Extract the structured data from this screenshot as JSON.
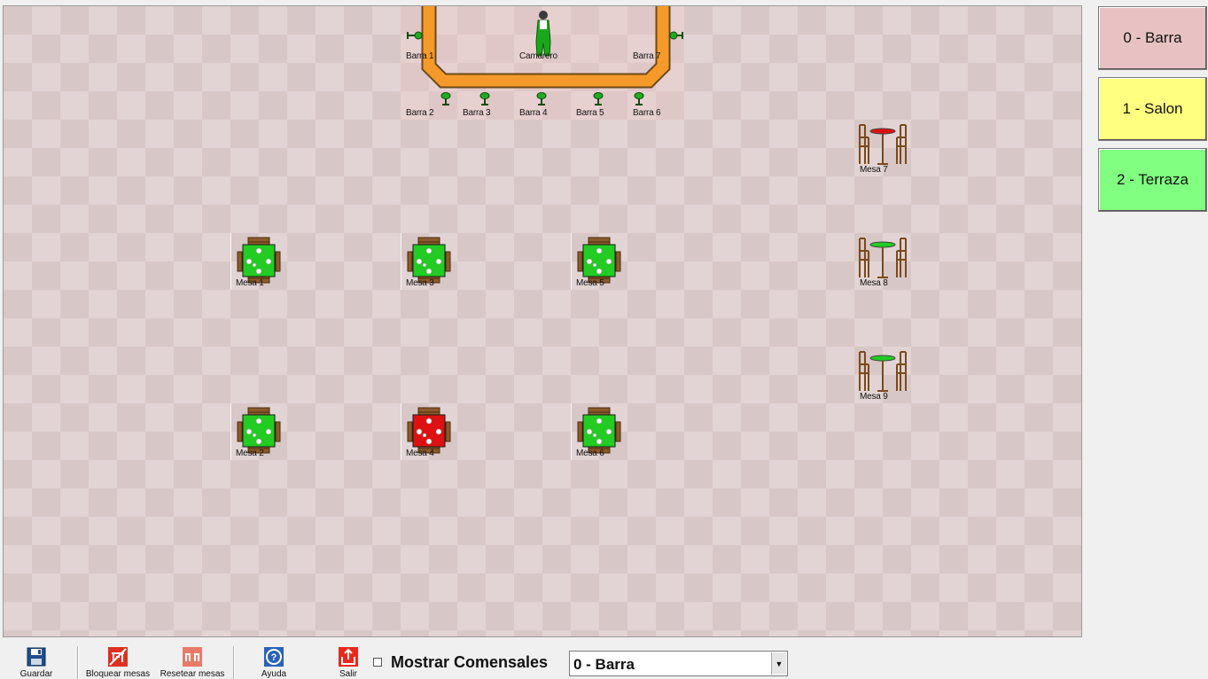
{
  "floor": {
    "bar_area": {
      "stools": [
        {
          "label": "Barra 1",
          "pos": "left"
        },
        {
          "label": "Barra 7",
          "pos": "right"
        },
        {
          "label": "Barra 2"
        },
        {
          "label": "Barra 3"
        },
        {
          "label": "Barra 4"
        },
        {
          "label": "Barra 5"
        },
        {
          "label": "Barra 6"
        }
      ],
      "waiter_label": "Camarero"
    },
    "tables": [
      {
        "label": "Mesa 1",
        "type": "square-4",
        "status": "free"
      },
      {
        "label": "Mesa 2",
        "type": "square-4",
        "status": "free"
      },
      {
        "label": "Mesa 3",
        "type": "square-4",
        "status": "free"
      },
      {
        "label": "Mesa 4",
        "type": "square-4",
        "status": "occupied"
      },
      {
        "label": "Mesa 5",
        "type": "square-4",
        "status": "free"
      },
      {
        "label": "Mesa 6",
        "type": "square-4",
        "status": "free"
      },
      {
        "label": "Mesa 7",
        "type": "high-round",
        "status": "occupied"
      },
      {
        "label": "Mesa 8",
        "type": "high-round",
        "status": "free"
      },
      {
        "label": "Mesa 9",
        "type": "high-round",
        "status": "free"
      }
    ]
  },
  "zones": [
    {
      "label": "0 - Barra",
      "color": "#e8c2c2"
    },
    {
      "label": "1 - Salon",
      "color": "#ffff80"
    },
    {
      "label": "2 - Terraza",
      "color": "#80ff80"
    }
  ],
  "toolbar": {
    "save_label": "Guardar",
    "lock_label": "Bloquear mesas",
    "reset_label": "Resetear mesas",
    "help_label": "Ayuda",
    "exit_label": "Salir",
    "show_diners_label": "Mostrar Comensales",
    "zone_select_value": "0 - Barra"
  },
  "colors": {
    "free": "#22cc22",
    "occupied": "#dd1111",
    "bar_counter": "#f59a2a"
  }
}
